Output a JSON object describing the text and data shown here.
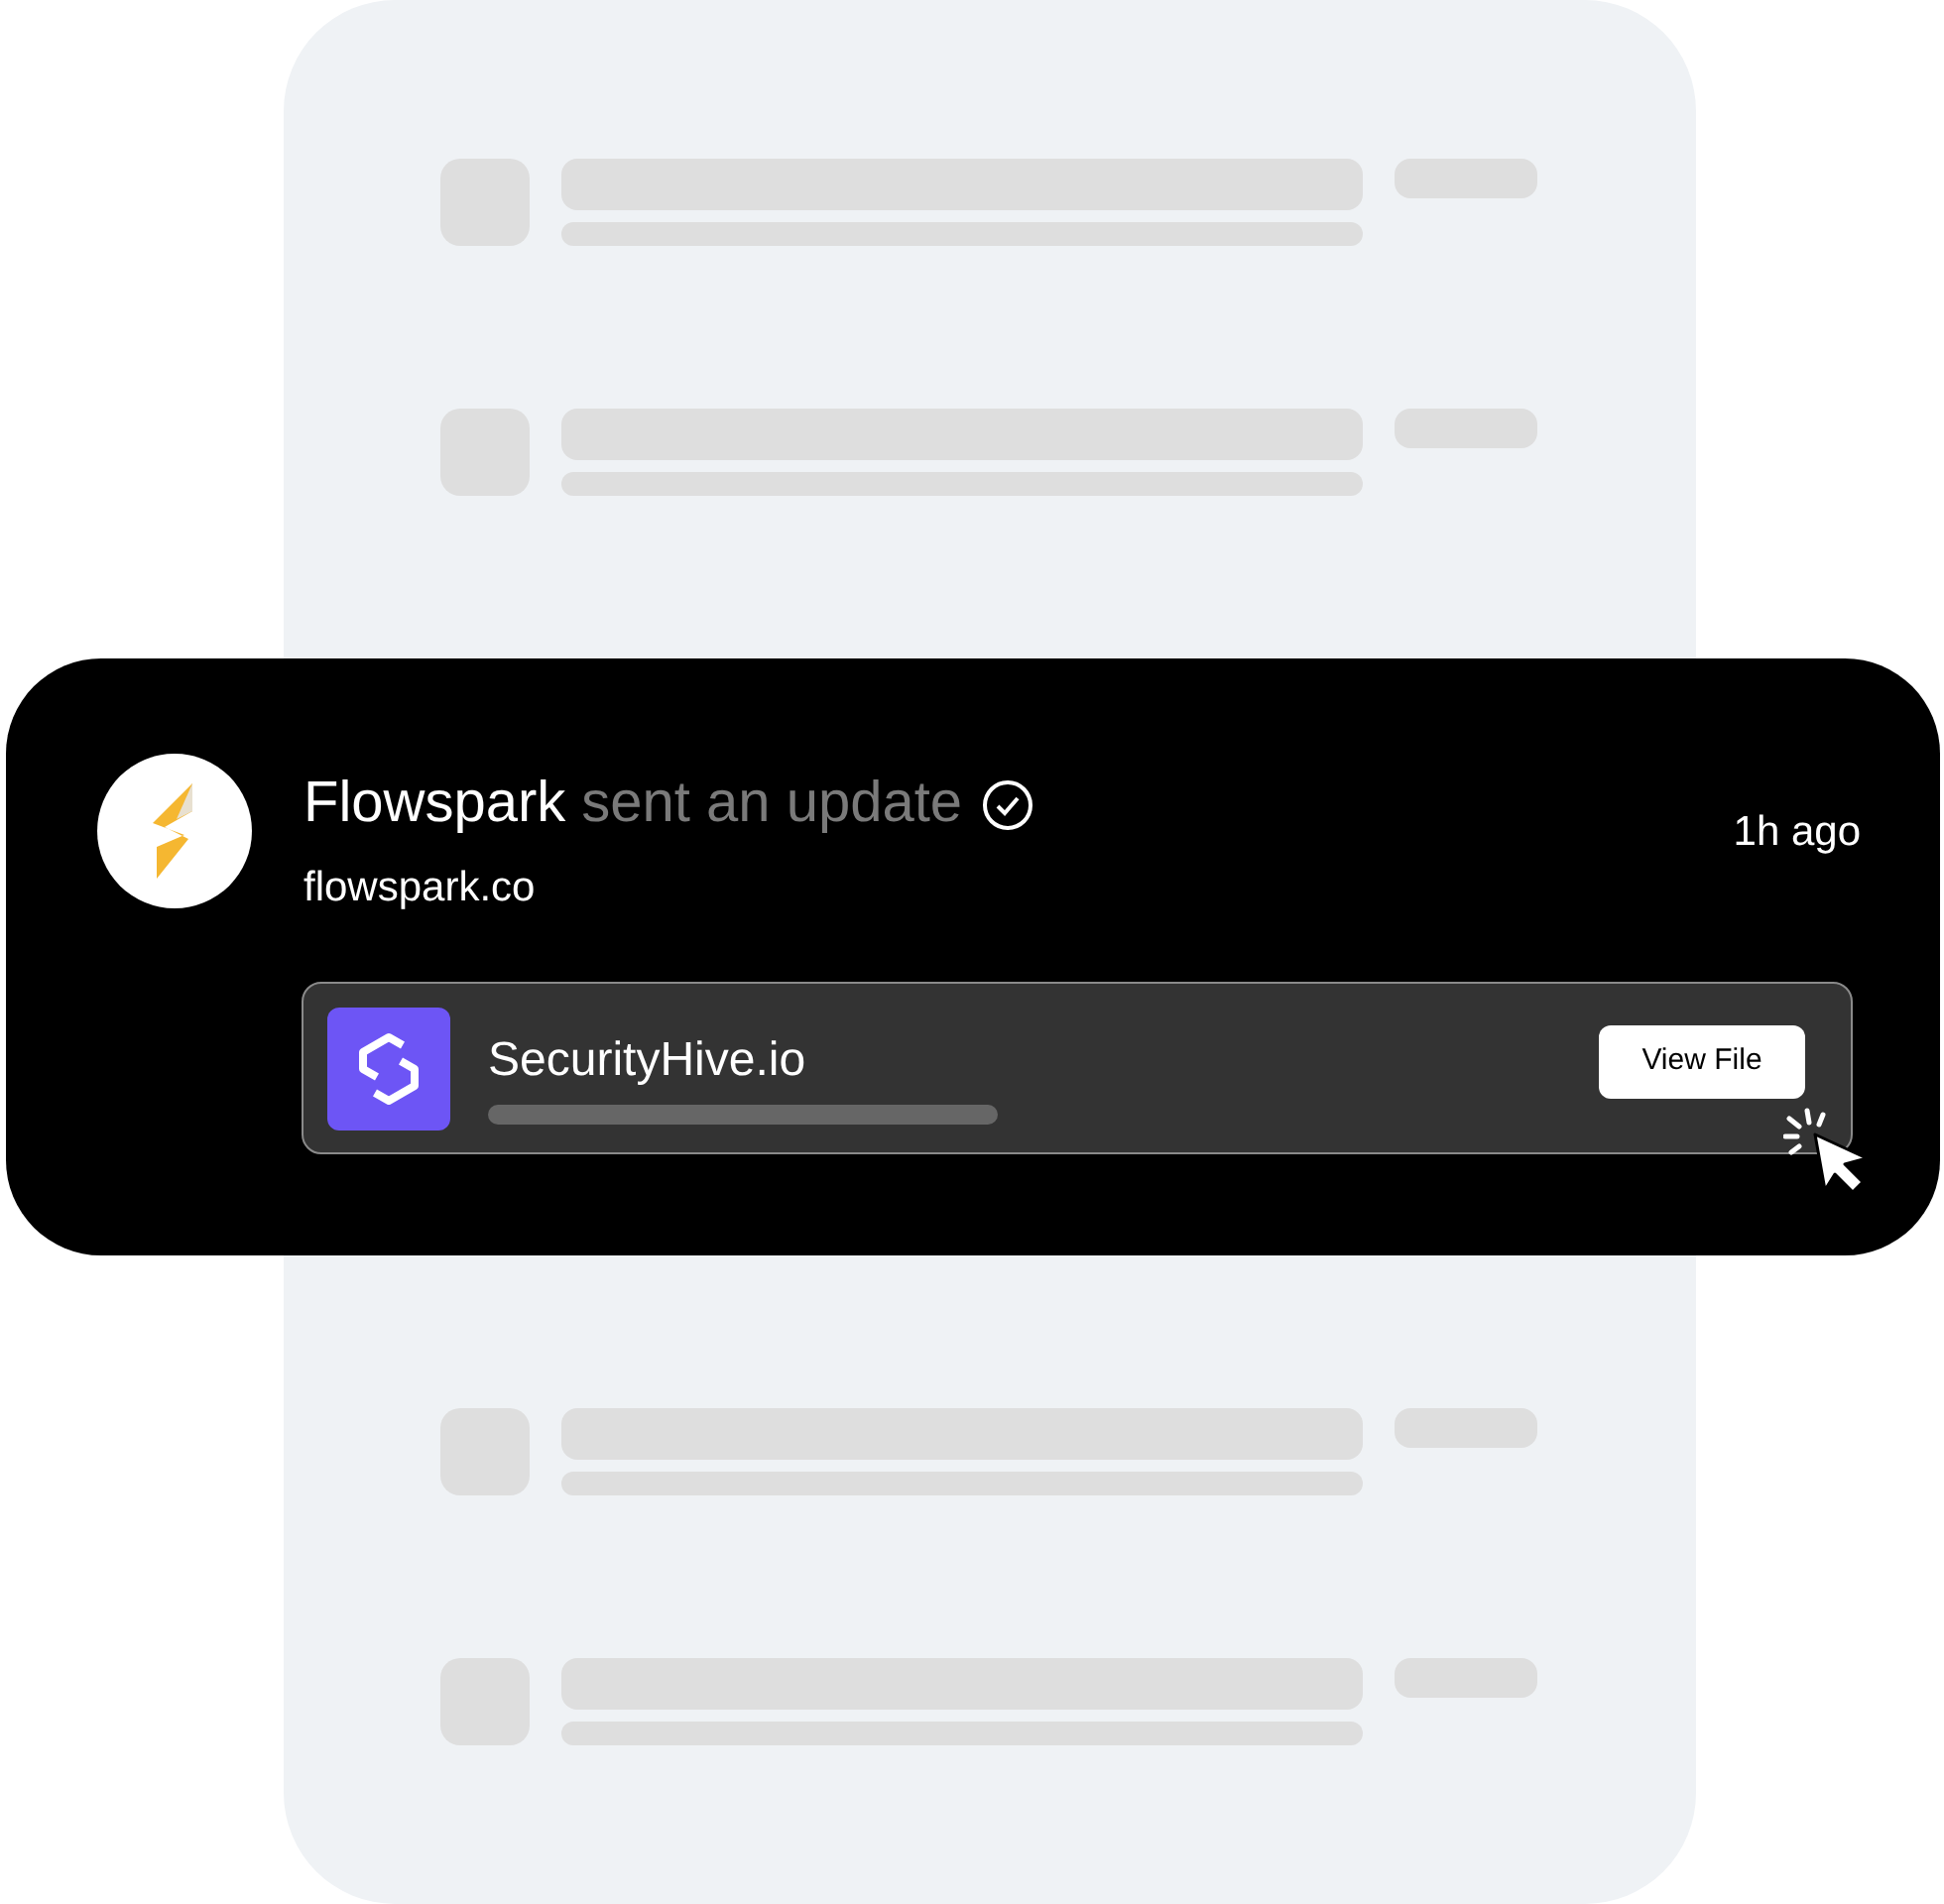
{
  "notification": {
    "sender": "Flowspark",
    "action": "sent an update",
    "verified": true,
    "domain": "flowspark.co",
    "time": "1h ago",
    "attachment": {
      "name": "SecurityHive.io",
      "button": "View File"
    }
  }
}
